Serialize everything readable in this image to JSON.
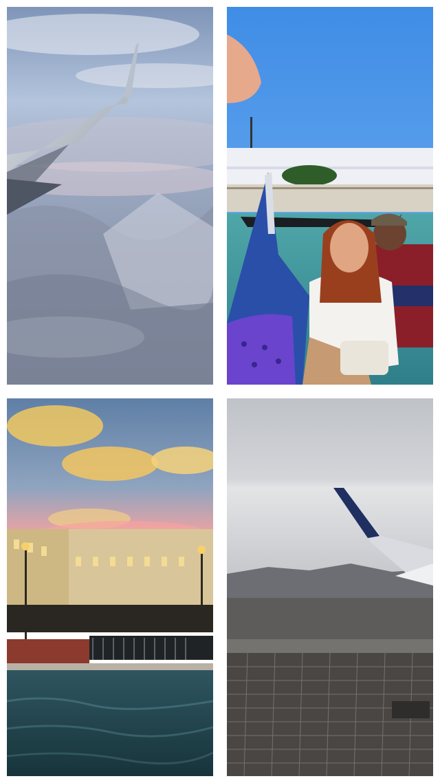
{
  "collage": {
    "layout": "2x2 grid",
    "background": "#ffffff",
    "tiles": [
      {
        "subject": "airplane-wing-over-clouds-and-desert-mountains",
        "palette": [
          "#8aa3c2",
          "#c9d4e3",
          "#5d6f8a",
          "#e7dfe3"
        ]
      },
      {
        "subject": "couple-in-gondola-on-outdoor-canal",
        "palette": [
          "#4a90e8",
          "#2f5fb0",
          "#6e4bd0",
          "#f2f2f2"
        ]
      },
      {
        "subject": "indoor-venetian-canal-under-painted-sunset-sky",
        "palette": [
          "#f3c35a",
          "#f39a9a",
          "#223c44",
          "#e9d8a8"
        ]
      },
      {
        "subject": "airplane-wing-over-city-grid-and-mountains",
        "palette": [
          "#c9ccd2",
          "#24355f",
          "#6a6a6c",
          "#3e3a3a"
        ]
      }
    ]
  }
}
